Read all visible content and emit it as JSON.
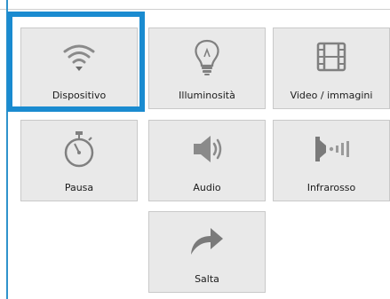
{
  "tiles": [
    {
      "label": "Dispositivo",
      "icon": "wifi-icon"
    },
    {
      "label": "Illuminosità",
      "icon": "lightbulb-icon"
    },
    {
      "label": "Video / immagini",
      "icon": "film-icon"
    },
    {
      "label": "Pausa",
      "icon": "stopwatch-icon"
    },
    {
      "label": "Audio",
      "icon": "speaker-icon"
    },
    {
      "label": "Infrarosso",
      "icon": "infrared-icon"
    },
    {
      "label": "Salta",
      "icon": "redo-arrow-icon"
    }
  ],
  "colors": {
    "highlight": "#1a8bd0",
    "tile_bg": "#e9e9e9",
    "icon": "#808080"
  }
}
